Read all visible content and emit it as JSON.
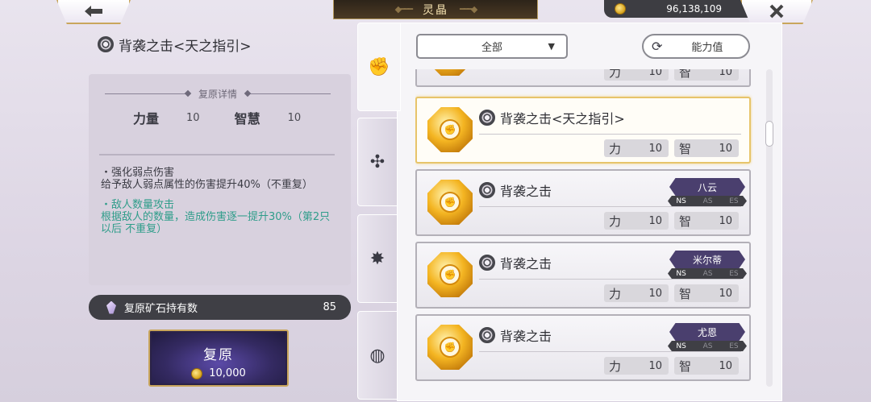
{
  "header": {
    "title": "灵晶",
    "currency_amount": "96,138,109"
  },
  "detail": {
    "skill_name": "背袭之击<天之指引>",
    "section_title": "复原详情",
    "stats": [
      {
        "name": "力量",
        "value": "10"
      },
      {
        "name": "智慧",
        "value": "10"
      }
    ],
    "effects": [
      {
        "title": "・强化弱点伤害",
        "desc": "给予敌人弱点属性的伤害提升40%（不重复）",
        "highlight": false
      },
      {
        "title": "・敌人数量攻击",
        "desc": "根据敌人的数量，造成伤害逐一提升30%（第2只以后 不重复）",
        "highlight": true
      }
    ],
    "ore_label": "复原矿石持有数",
    "ore_count": "85",
    "restore_label": "复原",
    "restore_cost": "10,000"
  },
  "filter": {
    "selected": "全部",
    "stat_button_label": "能力值"
  },
  "tabs": [
    {
      "icon": "fist-icon",
      "glyph": "✊",
      "active": true
    },
    {
      "icon": "swirl-plus-icon",
      "glyph": "✣",
      "active": false
    },
    {
      "icon": "star-burst-icon",
      "glyph": "✸",
      "active": false
    },
    {
      "icon": "spiral-icon",
      "glyph": "◍",
      "active": false
    }
  ],
  "list": {
    "partial_top": {
      "stats": [
        {
          "k": "力",
          "v": "10"
        },
        {
          "k": "智",
          "v": "10"
        }
      ]
    },
    "items": [
      {
        "name": "背袭之击<天之指引>",
        "selected": true,
        "character": "",
        "stats": [
          {
            "k": "力",
            "v": "10"
          },
          {
            "k": "智",
            "v": "10"
          }
        ]
      },
      {
        "name": "背袭之击",
        "selected": false,
        "character": "八云",
        "attrs": [
          "NS",
          "AS",
          "ES"
        ],
        "stats": [
          {
            "k": "力",
            "v": "10"
          },
          {
            "k": "智",
            "v": "10"
          }
        ]
      },
      {
        "name": "背袭之击",
        "selected": false,
        "character": "米尔蒂",
        "attrs": [
          "NS",
          "AS",
          "ES"
        ],
        "stats": [
          {
            "k": "力",
            "v": "10"
          },
          {
            "k": "智",
            "v": "10"
          }
        ]
      },
      {
        "name": "背袭之击",
        "selected": false,
        "character": "尤恩",
        "attrs": [
          "NS",
          "AS",
          "ES"
        ],
        "stats": [
          {
            "k": "力",
            "v": "10"
          },
          {
            "k": "智",
            "v": "10"
          }
        ]
      }
    ]
  },
  "colors": {
    "accent_gold": "#c9a65c",
    "teal_text": "#2f9d8a",
    "tag_purple": "#4a3f6e"
  }
}
